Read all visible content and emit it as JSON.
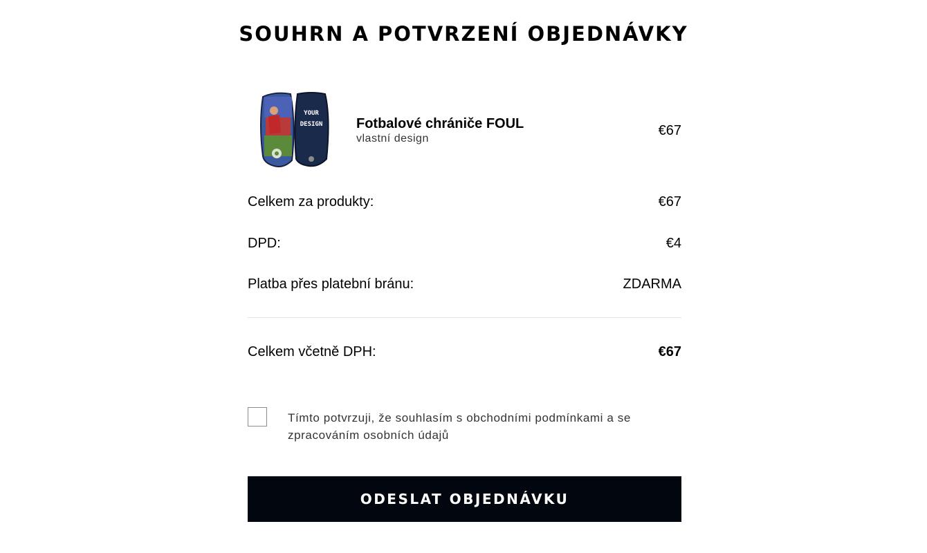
{
  "page": {
    "title": "SOUHRN A POTVRZENÍ OBJEDNÁVKY"
  },
  "product": {
    "name": "Fotbalové chrániče FOUL",
    "subtitle": "vlastní design",
    "price": "€67",
    "image_alt": "Fotbalové chrániče FOUL",
    "image_text": "YOUR DESIGN"
  },
  "summary": {
    "rows": [
      {
        "label": "Celkem za produkty:",
        "value": "€67"
      },
      {
        "label": "DPD:",
        "value": "€4"
      },
      {
        "label": "Platba přes platební bránu:",
        "value": "ZDARMA"
      }
    ],
    "total": {
      "label": "Celkem včetně DPH:",
      "value": "€67"
    }
  },
  "consent": {
    "checked": false,
    "text": "Tímto potvrzuji, že souhlasím s obchodními podmínkami a se zpracováním osobních údajů"
  },
  "submit": {
    "label": "ODESLAT OBJEDNÁVKU"
  },
  "colors": {
    "button_bg": "#02060e",
    "divider": "#e4e4e4",
    "text": "#000000"
  }
}
